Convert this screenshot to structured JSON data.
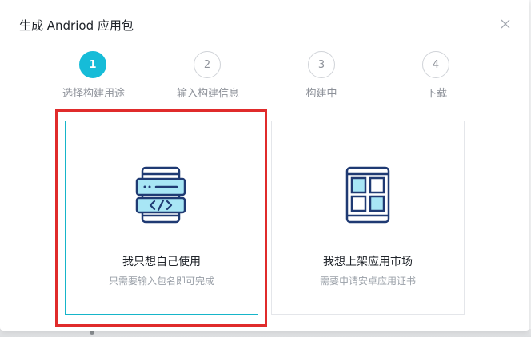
{
  "dialog": {
    "title": "生成 Andriod 应用包"
  },
  "steps": [
    {
      "number": "1",
      "label": "选择构建用途",
      "active": true
    },
    {
      "number": "2",
      "label": "输入构建信息",
      "active": false
    },
    {
      "number": "3",
      "label": "构建中",
      "active": false
    },
    {
      "number": "4",
      "label": "下载",
      "active": false
    }
  ],
  "options": [
    {
      "icon": "code-app-icon",
      "title": "我只想自己使用",
      "description": "只需要输入包名即可完成",
      "selected": true
    },
    {
      "icon": "app-grid-icon",
      "title": "我想上架应用市场",
      "description": "需要申请安卓应用证书",
      "selected": false
    }
  ],
  "colors": {
    "accent": "#16bcd8",
    "highlight": "#e02b2b",
    "icon_stroke": "#1f3a73",
    "icon_fill": "#a8e6f5"
  }
}
